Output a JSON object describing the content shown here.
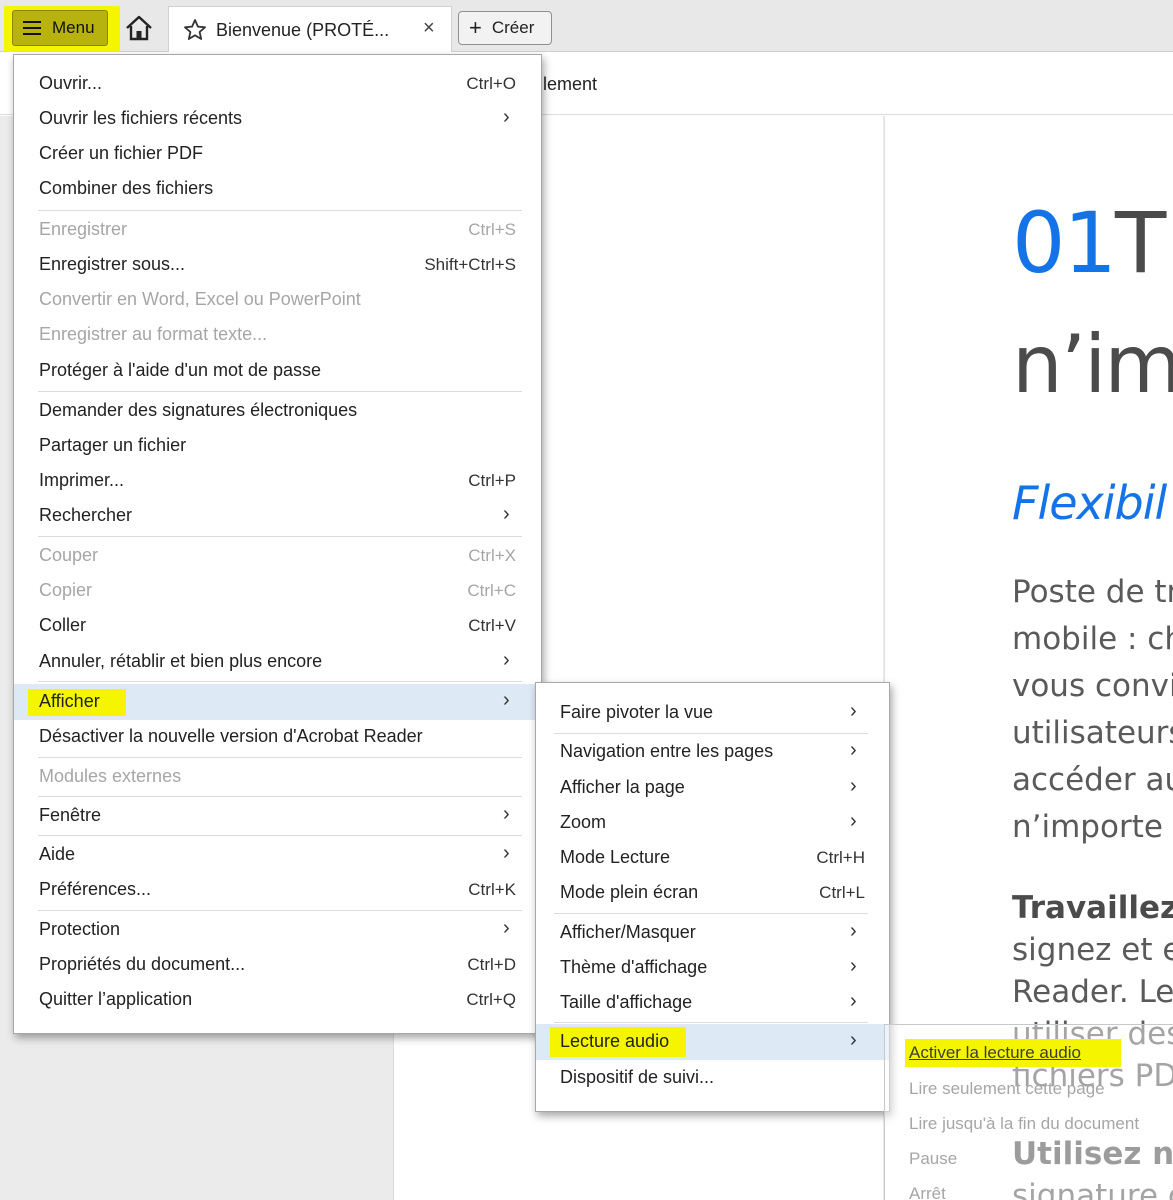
{
  "tab_bar": {
    "menu_label": "Menu",
    "home_icon": "home-icon",
    "doc_tab_title": "Bienvenue (PROTÉ...",
    "doc_tab_close": "×",
    "create_label": "Créer"
  },
  "toolbar": {
    "partial_text": "lement"
  },
  "page": {
    "heading_number": "01",
    "heading_rest": "T",
    "heading_line2": "n’im",
    "subtitle": "Flexibil",
    "para1": [
      "Poste de tra",
      "mobile : ch",
      "vous convie",
      "utilisateurs",
      "accéder au",
      "n’importe c"
    ],
    "para2_bold": "Travaillez s",
    "para2": [
      "signez et env",
      "Reader. Les a",
      "utiliser des o",
      "fichiers PDF."
    ],
    "para3_bold": "Utilisez n’im",
    "para3": [
      "signature co"
    ]
  },
  "main_menu": {
    "items": [
      {
        "label": "Ouvrir...",
        "shortcut": "Ctrl+O"
      },
      {
        "label": "Ouvrir les fichiers récents",
        "arrow": "›"
      },
      {
        "label": "Créer un fichier PDF"
      },
      {
        "label": "Combiner des fichiers"
      },
      {
        "label": "Enregistrer",
        "shortcut": "Ctrl+S",
        "disabled": true
      },
      {
        "label": "Enregistrer sous...",
        "shortcut": "Shift+Ctrl+S"
      },
      {
        "label": "Convertir en Word, Excel ou PowerPoint",
        "disabled": true
      },
      {
        "label": "Enregistrer au format texte...",
        "disabled": true
      },
      {
        "label": "Protéger à l'aide d'un mot de passe"
      },
      {
        "label": "Demander des signatures électroniques"
      },
      {
        "label": "Partager un fichier"
      },
      {
        "label": "Imprimer...",
        "shortcut": "Ctrl+P"
      },
      {
        "label": "Rechercher",
        "arrow": "›"
      },
      {
        "label": "Couper",
        "shortcut": "Ctrl+X",
        "disabled": true
      },
      {
        "label": "Copier",
        "shortcut": "Ctrl+C",
        "disabled": true
      },
      {
        "label": "Coller",
        "shortcut": "Ctrl+V"
      },
      {
        "label": "Annuler, rétablir et bien plus encore",
        "arrow": "›"
      },
      {
        "label": "Afficher",
        "arrow": "›",
        "selected": true
      },
      {
        "label": "Désactiver la nouvelle version d'Acrobat Reader"
      },
      {
        "label": "Modules externes",
        "disabled": true
      },
      {
        "label": "Fenêtre",
        "arrow": "›"
      },
      {
        "label": "Aide",
        "arrow": "›"
      },
      {
        "label": "Préférences...",
        "shortcut": "Ctrl+K"
      },
      {
        "label": "Protection",
        "arrow": "›"
      },
      {
        "label": "Propriétés du document...",
        "shortcut": "Ctrl+D"
      },
      {
        "label": "Quitter l’application",
        "shortcut": "Ctrl+Q"
      }
    ]
  },
  "view_submenu": {
    "items": [
      {
        "label": "Faire pivoter la vue",
        "arrow": "›"
      },
      {
        "label": "Navigation entre les pages",
        "arrow": "›"
      },
      {
        "label": "Afficher la page",
        "arrow": "›"
      },
      {
        "label": "Zoom",
        "arrow": "›"
      },
      {
        "label": "Mode Lecture",
        "shortcut": "Ctrl+H"
      },
      {
        "label": "Mode plein écran",
        "shortcut": "Ctrl+L"
      },
      {
        "label": "Afficher/Masquer",
        "arrow": "›"
      },
      {
        "label": "Thème d'affichage",
        "arrow": "›"
      },
      {
        "label": "Taille d'affichage",
        "arrow": "›"
      },
      {
        "label": "Lecture audio",
        "arrow": "›",
        "selected": true
      },
      {
        "label": "Dispositif de suivi..."
      }
    ]
  },
  "audio_submenu": {
    "items": [
      {
        "label": "Activer la lecture audio",
        "active": true
      },
      {
        "label": "Lire seulement cette page"
      },
      {
        "label": "Lire jusqu'à la fin du document"
      },
      {
        "label": "Pause"
      },
      {
        "label": "Arrêt"
      }
    ]
  },
  "colors": {
    "highlight": "#f5f500",
    "accent_blue": "#1473e6",
    "selected_row": "#dde9f5",
    "disabled_text": "#a6a6a6"
  }
}
